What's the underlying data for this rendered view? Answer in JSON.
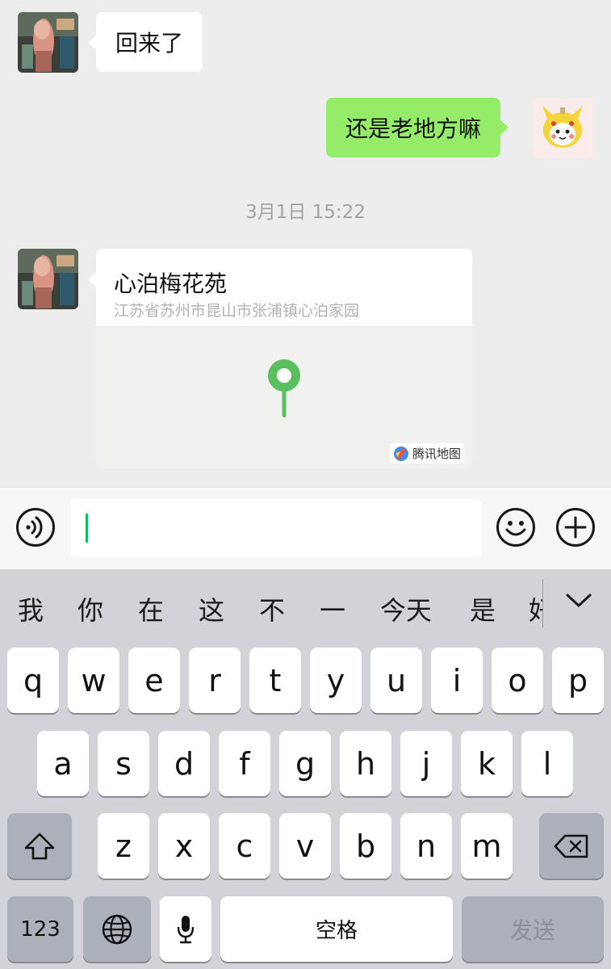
{
  "chat": {
    "messages": [
      {
        "side": "left",
        "text": "回来了"
      },
      {
        "side": "right",
        "text": "还是老地方嘛"
      }
    ],
    "timestamp": "3月1日 15:22",
    "location": {
      "name": "心泊梅花苑",
      "address": "江苏省苏州市昆山市张浦镇心泊家园",
      "map_brand": "腾讯地图",
      "pin_color": "#5ac05f"
    }
  },
  "input": {
    "value": "",
    "accent": "#07c160"
  },
  "keyboard": {
    "candidates": [
      "我",
      "你",
      "在",
      "这",
      "不",
      "一",
      "今天",
      "是",
      "好"
    ],
    "rows": [
      [
        "q",
        "w",
        "e",
        "r",
        "t",
        "y",
        "u",
        "i",
        "o",
        "p"
      ],
      [
        "a",
        "s",
        "d",
        "f",
        "g",
        "h",
        "j",
        "k",
        "l"
      ],
      [
        "z",
        "x",
        "c",
        "v",
        "b",
        "n",
        "m"
      ]
    ],
    "numbers_label": "123",
    "space_label": "空格",
    "send_label": "发送"
  }
}
